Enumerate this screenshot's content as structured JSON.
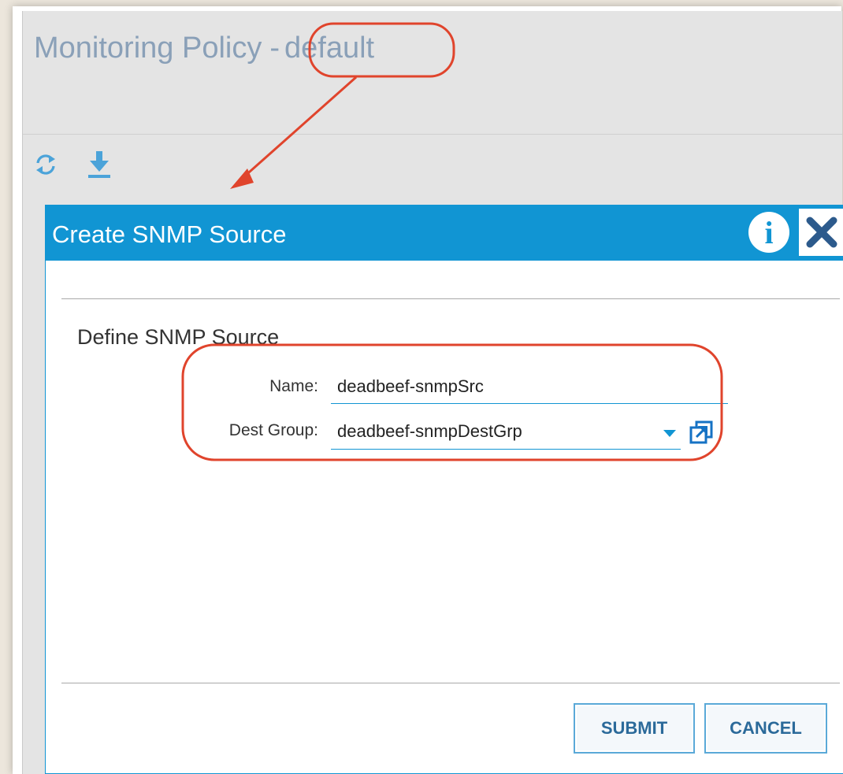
{
  "page": {
    "title_prefix": "Monitoring Policy",
    "title_separator": "-",
    "title_name": "default"
  },
  "toolbar": {
    "refresh_icon": "refresh-icon",
    "download_icon": "download-icon"
  },
  "dialog": {
    "title": "Create SNMP Source",
    "info_label": "i",
    "section_title": "Define SNMP Source",
    "fields": {
      "name": {
        "label": "Name:",
        "value": "deadbeef-snmpSrc"
      },
      "dest_group": {
        "label": "Dest Group:",
        "value": "deadbeef-snmpDestGrp"
      }
    },
    "submit_label": "SUBMIT",
    "cancel_label": "CANCEL"
  },
  "colors": {
    "accent": "#1195d3",
    "title_text": "#8aa0b8",
    "annotation": "#e0442c",
    "button_text": "#2b6a9a"
  }
}
